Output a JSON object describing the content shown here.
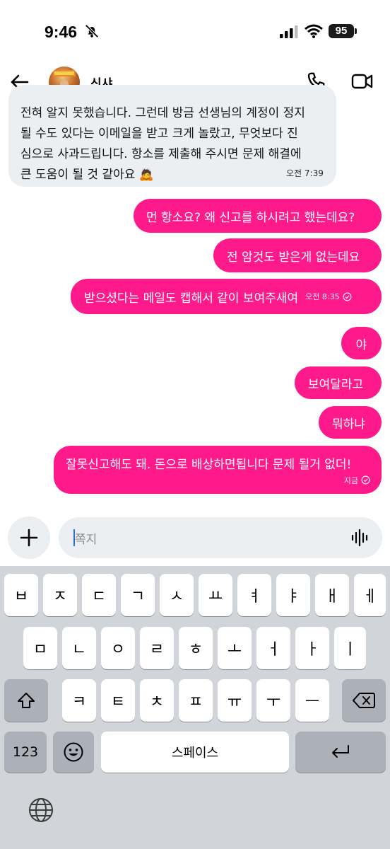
{
  "status_bar": {
    "time": "9:46",
    "battery": "95"
  },
  "header": {
    "contact_name": "신샤"
  },
  "messages": [
    {
      "direction": "in",
      "lines": [
        "전혀 알지 못했습니다. 그런데 방금 선생님의 계정이 정지",
        "될 수도 있다는 이메일을 받고 크게 놀랐고, 무엇보다 진",
        "심으로 사과드립니다. 항소를 제출해 주시면 문제 해결에",
        "큰 도움이 될 것 같아요 🙇"
      ],
      "time": "오전 7:39"
    },
    {
      "direction": "out",
      "text": "먼 항소요? 왜 신고를 하시려고 했는데요?"
    },
    {
      "direction": "out",
      "text": "전 암것도 받은게 없는데요"
    },
    {
      "direction": "out",
      "text": "받으셨다는 메일도 캡해서 같이 보여주새여",
      "time": "오전 8:35"
    },
    {
      "direction": "out",
      "text": "야"
    },
    {
      "direction": "out",
      "text": "보여달라고"
    },
    {
      "direction": "out",
      "text": "뭐하냐"
    },
    {
      "direction": "out",
      "text": "잘못신고해도 돼. 돈으로 배상하면됩니다 문제 될거 없더!",
      "time": "지금"
    }
  ],
  "composer": {
    "placeholder": "쪽지"
  },
  "keyboard": {
    "row1": [
      "ㅂ",
      "ㅈ",
      "ㄷ",
      "ㄱ",
      "ㅅ",
      "ㅛ",
      "ㅕ",
      "ㅑ",
      "ㅐ",
      "ㅔ"
    ],
    "row2": [
      "ㅁ",
      "ㄴ",
      "ㅇ",
      "ㄹ",
      "ㅎ",
      "ㅗ",
      "ㅓ",
      "ㅏ",
      "ㅣ"
    ],
    "row3": [
      "ㅋ",
      "ㅌ",
      "ㅊ",
      "ㅍ",
      "ㅠ",
      "ㅜ",
      "ㅡ"
    ],
    "numbers_label": "123",
    "space_label": "스페이스"
  },
  "colors": {
    "outgoing_bubble": "#ff1a8c",
    "incoming_bubble": "#eceff1",
    "keyboard_bg": "#d1d4d9"
  },
  "icons": [
    "bell-slash-icon",
    "signal-icon",
    "wifi-icon",
    "back-arrow-icon",
    "phone-icon",
    "video-icon",
    "plus-icon",
    "voice-wave-icon",
    "shift-icon",
    "backspace-icon",
    "emoji-icon",
    "return-icon",
    "globe-icon"
  ]
}
